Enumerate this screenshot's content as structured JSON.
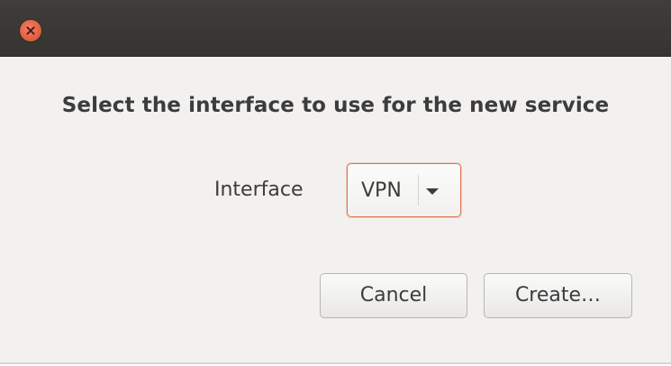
{
  "dialog": {
    "heading": "Select the interface to use for the new service",
    "interface_label": "Interface",
    "interface_selected": "VPN",
    "cancel_label": "Cancel",
    "create_label": "Create…"
  },
  "icons": {
    "close": "close-icon",
    "dropdown": "chevron-down-icon"
  },
  "colors": {
    "titlebar": "#3c3b37",
    "close_button": "#e0613f",
    "focus_border": "#e2714c",
    "background": "#f2f1f0"
  }
}
